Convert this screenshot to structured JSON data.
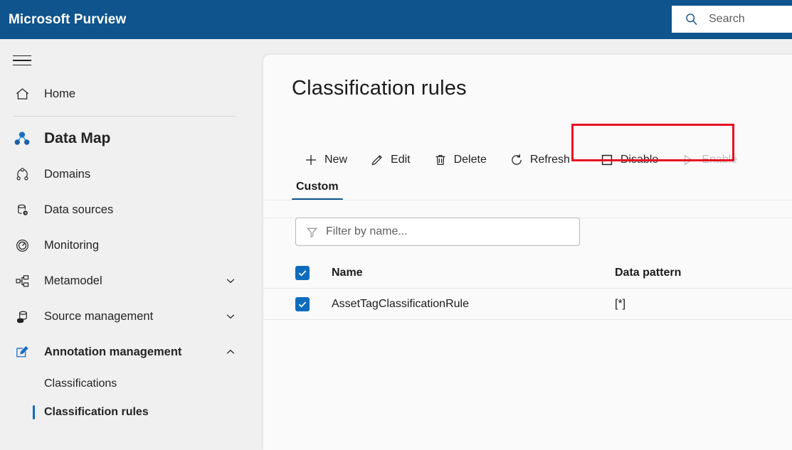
{
  "header": {
    "brand": "Microsoft Purview",
    "search_placeholder": "Search",
    "search_icon": "search-icon",
    "bg_color": "#0f548c"
  },
  "sidebar": {
    "menu_icon": "hamburger-icon",
    "items": [
      {
        "label": "Home",
        "icon": "home-icon",
        "type": "link",
        "expandable": false
      },
      {
        "label": "Data Map",
        "icon": "data-map-icon",
        "type": "section",
        "expandable": false
      },
      {
        "label": "Domains",
        "icon": "domains-icon",
        "type": "link",
        "expandable": false
      },
      {
        "label": "Data sources",
        "icon": "data-sources-icon",
        "type": "link",
        "expandable": false
      },
      {
        "label": "Monitoring",
        "icon": "monitoring-icon",
        "type": "link",
        "expandable": false
      },
      {
        "label": "Metamodel",
        "icon": "metamodel-icon",
        "type": "group",
        "expandable": true,
        "expanded": false
      },
      {
        "label": "Source management",
        "icon": "source-management-icon",
        "type": "group",
        "expandable": true,
        "expanded": false
      },
      {
        "label": "Annotation management",
        "icon": "annotation-management-icon",
        "type": "group",
        "expandable": true,
        "expanded": true
      }
    ],
    "sub_items": [
      {
        "label": "Classifications",
        "active": false
      },
      {
        "label": "Classification rules",
        "active": true
      }
    ],
    "accent_color": "#0f6cbd"
  },
  "main": {
    "title": "Classification rules",
    "toolbar": [
      {
        "label": "New",
        "icon": "plus-icon",
        "disabled": false
      },
      {
        "label": "Edit",
        "icon": "pencil-icon",
        "disabled": false
      },
      {
        "label": "Delete",
        "icon": "trash-icon",
        "disabled": false
      },
      {
        "label": "Refresh",
        "icon": "refresh-icon",
        "disabled": false
      },
      {
        "label": "Disable",
        "icon": "square-icon",
        "disabled": false
      },
      {
        "label": "Enable",
        "icon": "play-triangle-icon",
        "disabled": true
      }
    ],
    "tabs": [
      {
        "label": "Custom",
        "active": true
      }
    ],
    "filter": {
      "placeholder": "Filter by name...",
      "value": "",
      "icon": "filter-icon"
    },
    "table": {
      "columns": [
        "Name",
        "Data pattern"
      ],
      "header_checkbox_checked": true,
      "rows": [
        {
          "checked": true,
          "name": "AssetTagClassificationRule",
          "data_pattern": "[*]"
        }
      ]
    },
    "highlight_color": "#e81123"
  }
}
